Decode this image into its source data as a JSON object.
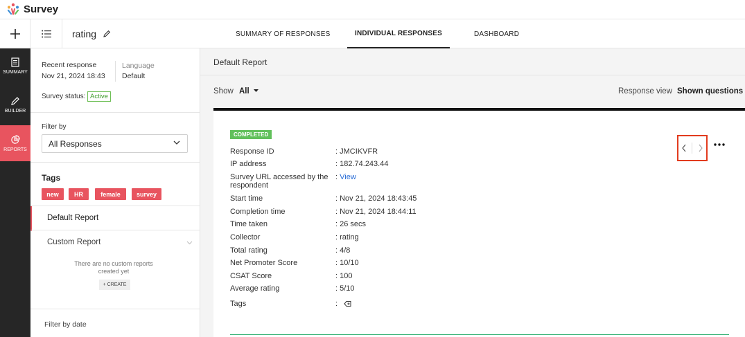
{
  "app": {
    "title": "Survey",
    "logo_icon": "survey-logo-icon"
  },
  "toolbar": {
    "add_icon": "plus-icon",
    "menu_icon": "menu-icon",
    "survey_name": "rating",
    "edit_icon": "pencil-icon",
    "tabs": [
      {
        "label": "SUMMARY OF RESPONSES",
        "active": false
      },
      {
        "label": "INDIVIDUAL RESPONSES",
        "active": true
      },
      {
        "label": "DASHBOARD",
        "active": false
      }
    ]
  },
  "leftnav": {
    "items": [
      {
        "label": "SUMMARY",
        "icon": "document-icon",
        "active": false
      },
      {
        "label": "BUILDER",
        "icon": "pencil-icon",
        "active": false
      },
      {
        "label": "REPORTS",
        "icon": "pie-chart-icon",
        "active": true
      }
    ],
    "accent_color": "#e8545f"
  },
  "sidepanel": {
    "recent_response_label": "Recent response",
    "recent_response_value": "Nov 21, 2024 18:43",
    "language_label": "Language",
    "language_value": "Default",
    "survey_status_label": "Survey status:",
    "survey_status_value": "Active",
    "filter_label": "Filter by",
    "filter_value": "All Responses",
    "tags_label": "Tags",
    "tags": [
      "new",
      "HR",
      "female",
      "survey"
    ],
    "default_report": "Default Report",
    "custom_report": "Custom Report",
    "no_reports_text": "There are no custom reports created yet",
    "create_label": "+ CREATE",
    "filter_by_date": "Filter by date"
  },
  "main": {
    "report_title": "Default Report",
    "show_label": "Show",
    "show_value": "All",
    "response_view_label": "Response view",
    "response_view_value": "Shown questions",
    "response": {
      "status": "COMPLETED",
      "status_color": "#61c05b",
      "fields": [
        {
          "key": "Response ID",
          "value": ": JMCIKVFR"
        },
        {
          "key": "IP address",
          "value": ": 182.74.243.44"
        },
        {
          "key": "Survey URL accessed by the respondent",
          "value": ":",
          "link": "View"
        },
        {
          "key": "Start time",
          "value": ": Nov 21, 2024 18:43:45"
        },
        {
          "key": "Completion time",
          "value": ": Nov 21, 2024 18:44:11"
        },
        {
          "key": "Time taken",
          "value": ": 26 secs"
        },
        {
          "key": "Collector",
          "value": ": rating"
        },
        {
          "key": "Total rating",
          "value": ": 4/8"
        },
        {
          "key": "Net Promoter Score",
          "value": ": 10/10"
        },
        {
          "key": "CSAT Score",
          "value": ": 100"
        },
        {
          "key": "Average rating",
          "value": ": 5/10"
        },
        {
          "key": "Tags",
          "value": ":",
          "icon": "tag-add-icon"
        }
      ]
    }
  }
}
